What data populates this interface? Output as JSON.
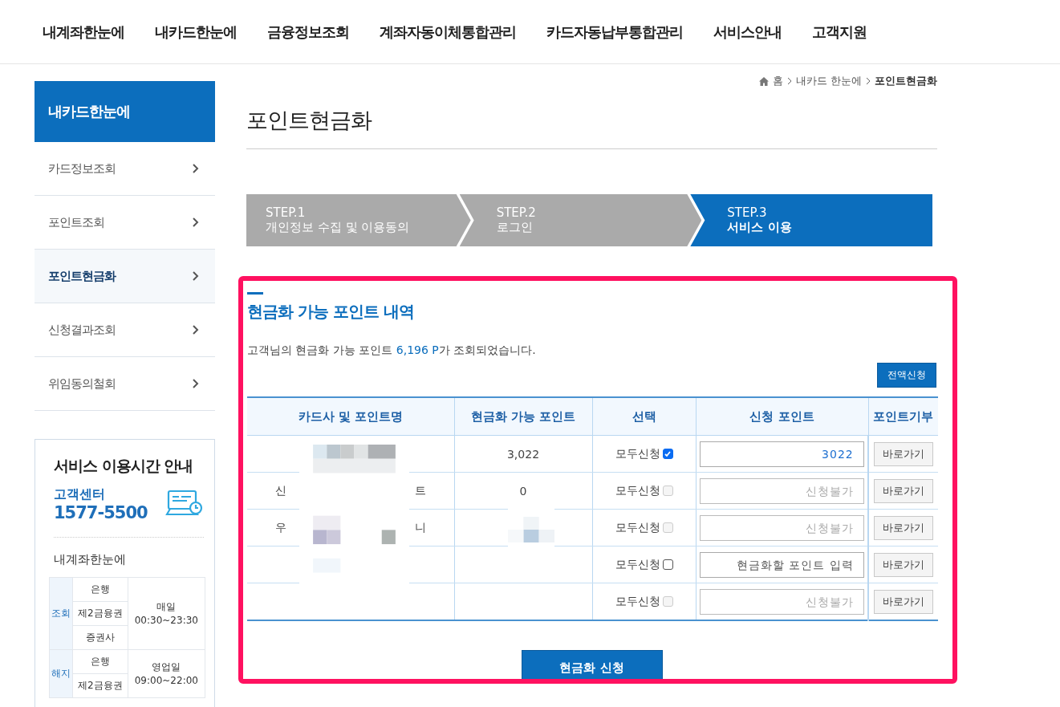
{
  "top_nav": [
    "내계좌한눈에",
    "내카드한눈에",
    "금융정보조회",
    "계좌자동이체통합관리",
    "카드자동납부통합관리",
    "서비스안내",
    "고객지원"
  ],
  "sidebar": {
    "title": "내카드한눈에",
    "items": [
      {
        "label": "카드정보조회",
        "selected": false
      },
      {
        "label": "포인트조회",
        "selected": false
      },
      {
        "label": "포인트현금화",
        "selected": true
      },
      {
        "label": "신청결과조회",
        "selected": false
      },
      {
        "label": "위임동의철회",
        "selected": false
      }
    ]
  },
  "service_hours": {
    "title": "서비스 이용시간 안내",
    "center_label": "고객센터",
    "phone": "1577-5500",
    "section": "내계좌한눈에",
    "groups": [
      {
        "name": "조회",
        "institutions": [
          "은행",
          "제2금융권",
          "증권사"
        ],
        "hours": [
          "매일",
          "00:30~23:30"
        ]
      },
      {
        "name": "해지",
        "institutions": [
          "은행",
          "제2금융권"
        ],
        "hours": [
          "영업일",
          "09:00~22:00"
        ]
      }
    ]
  },
  "breadcrumb": [
    "홈",
    "내카드 한눈에",
    "포인트현금화"
  ],
  "page_title": "포인트현금화",
  "steps": [
    {
      "step": "STEP.1",
      "label": "개인정보 수집 및 이용동의",
      "selected": false
    },
    {
      "step": "STEP.2",
      "label": "로그인",
      "selected": false
    },
    {
      "step": "STEP.3",
      "label": "서비스 이용",
      "selected": true
    }
  ],
  "section_title": "현금화 가능 포인트 내역",
  "summary": "고객님의 현금화 가능 포인트 **6,196 P**가 조회되었습니다.",
  "apply_all_button": "전액신청",
  "table": {
    "columns": [
      "카드사 및 포인트명",
      "현금화 가능 포인트",
      "선택",
      "신청 포인트",
      "포인트기부"
    ],
    "rows": [
      {
        "name_left": "",
        "name_right": "",
        "points": "3,022",
        "select_label": "모두신청",
        "checked": true,
        "disabled": false,
        "value": "3022",
        "placeholder": "",
        "button": "바로가기"
      },
      {
        "name_left": "신",
        "name_right": "트",
        "points": "0",
        "select_label": "모두신청",
        "checked": false,
        "disabled": true,
        "value": "",
        "placeholder": "신청불가",
        "button": "바로가기"
      },
      {
        "name_left": "우",
        "name_right": "니",
        "points": "",
        "select_label": "모두신청",
        "checked": false,
        "disabled": true,
        "value": "",
        "placeholder": "신청불가",
        "button": "바로가기"
      },
      {
        "name_left": "",
        "name_right": "",
        "points": "",
        "select_label": "모두신청",
        "checked": false,
        "disabled": false,
        "value": "",
        "placeholder": "현금화할 포인트 입력",
        "button": "바로가기"
      },
      {
        "name_left": "",
        "name_right": "",
        "points": "",
        "select_label": "모두신청",
        "checked": false,
        "disabled": true,
        "value": "",
        "placeholder": "신청불가",
        "button": "바로가기"
      }
    ]
  },
  "submit_button": "현금화 신청"
}
